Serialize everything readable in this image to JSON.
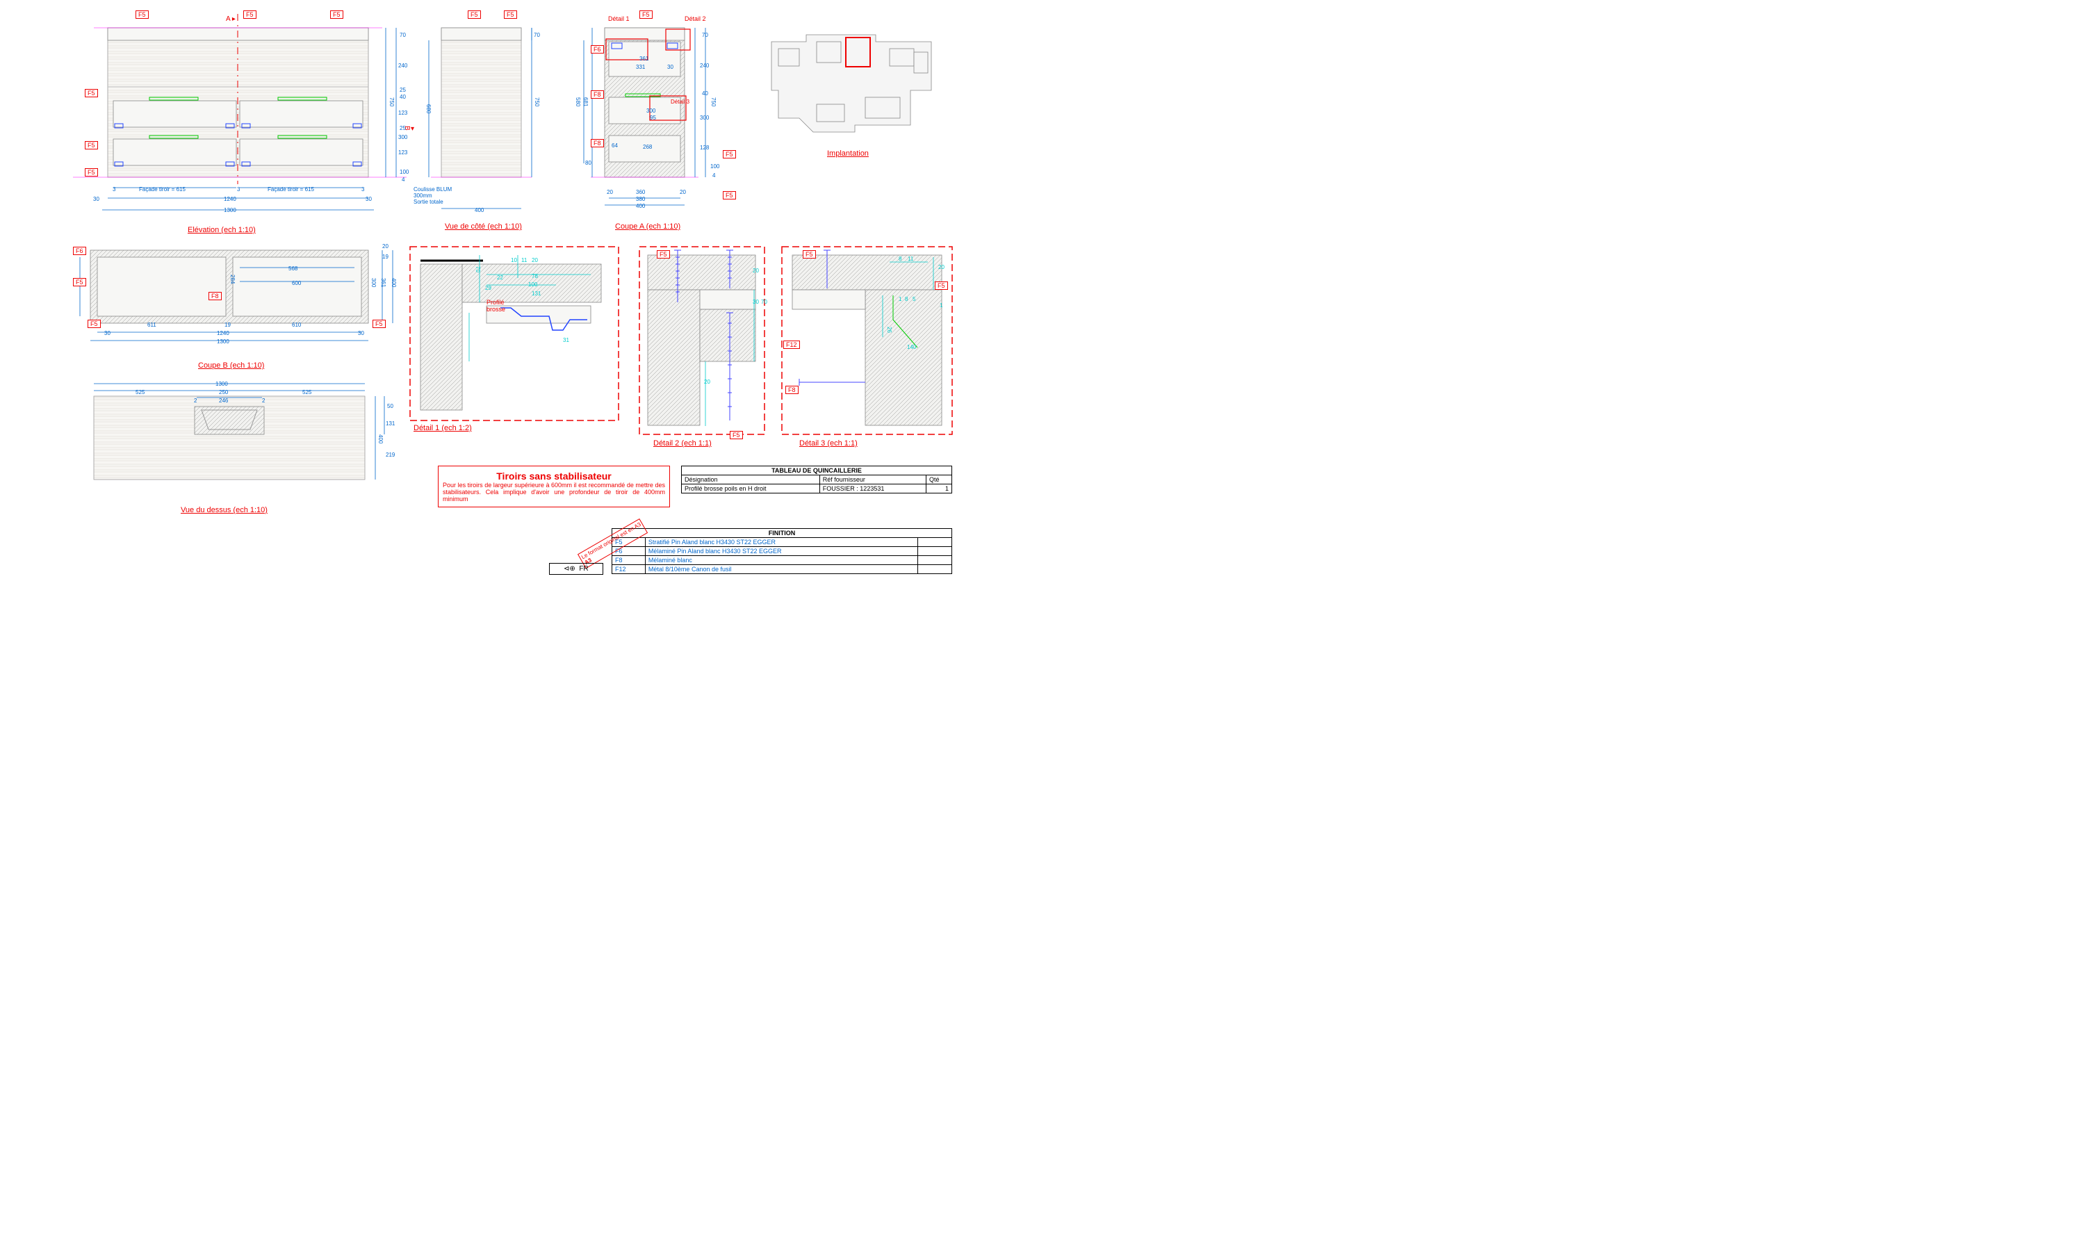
{
  "views": {
    "elevation": "Elévation (ech 1:10)",
    "side": "Vue de côté (ech 1:10)",
    "coupeA": "Coupe A (ech 1:10)",
    "coupeB": "Coupe B (ech 1:10)",
    "top": "Vue du dessus (ech 1:10)",
    "detail1": "Détail 1 (ech 1:2)",
    "detail2": "Détail 2 (ech 1:1)",
    "detail3": "Détail 3 (ech 1:1)",
    "implant": "Implantation"
  },
  "labels": {
    "detail1_top": "Détail 1",
    "detail2_top": "Détail 2",
    "detail3_top": "Détail 3",
    "A": "A",
    "B": "B",
    "facade": "Façade tiroir = 615",
    "coulisse": "Coulisse BLUM\n300mm\nSortie totale",
    "profil": "Profilé\nbrosse",
    "fr": "FR"
  },
  "tags": {
    "F5": "F5",
    "F6": "F6",
    "F8": "F8",
    "F12": "F12"
  },
  "dims": {
    "d1300": "1300",
    "d1240": "1240",
    "d30": "30",
    "d3": "3",
    "d615": "615",
    "d750": "750",
    "d70": "70",
    "d240": "240",
    "d25": "25",
    "d40": "40",
    "d123": "123",
    "d300": "300",
    "d100": "100",
    "d4": "4",
    "d680": "680",
    "d400": "400",
    "d360": "360",
    "d380": "380",
    "d20": "20",
    "d80": "80",
    "d580": "580",
    "d681": "681",
    "d361": "361",
    "d331": "331",
    "d268": "268",
    "d128": "128",
    "d64": "64",
    "d95": "95",
    "d611": "611",
    "d19": "19",
    "d610": "610",
    "d600": "600",
    "d568": "568",
    "d284": "284",
    "d525": "525",
    "d250": "250",
    "d246": "246",
    "d2": "2",
    "d219": "219",
    "d131": "131",
    "d50": "50",
    "d29": "29",
    "d22": "22",
    "d78": "78",
    "d10": "10",
    "d11": "11",
    "d31": "31",
    "d8": "8",
    "d5": "5",
    "d26": "26",
    "d140": "140",
    "d1": "1"
  },
  "note": {
    "title": "Tiroirs sans stabilisateur",
    "text": "Pour les tiroirs de largeur supérieure à 600mm il est recommandé de mettre des stabilisateurs. Cela implique d'avoir une profondeur de tiroir de 400mm minimum"
  },
  "quinc": {
    "title": "TABLEAU DE QUINCAILLERIE",
    "h1": "Désignation",
    "h2": "Réf fournisseur",
    "h3": "Qté",
    "r1c1": "Profilé brosse poils en H droit",
    "r1c2": "FOUSSIER : 1223531",
    "r1c3": "1"
  },
  "fin": {
    "title": "FINITION",
    "rows": [
      {
        "code": "F5",
        "desc": "Stratifié Pin Aland blanc H3430 ST22 EGGER"
      },
      {
        "code": "F6",
        "desc": "Mélaminé Pin Aland blanc H3430 ST22 EGGER"
      },
      {
        "code": "F8",
        "desc": "Mélaminé blanc"
      },
      {
        "code": "F12",
        "desc": "Métal 8/10ème Canon de fusil"
      }
    ]
  },
  "a3": "Le format original est en A3"
}
